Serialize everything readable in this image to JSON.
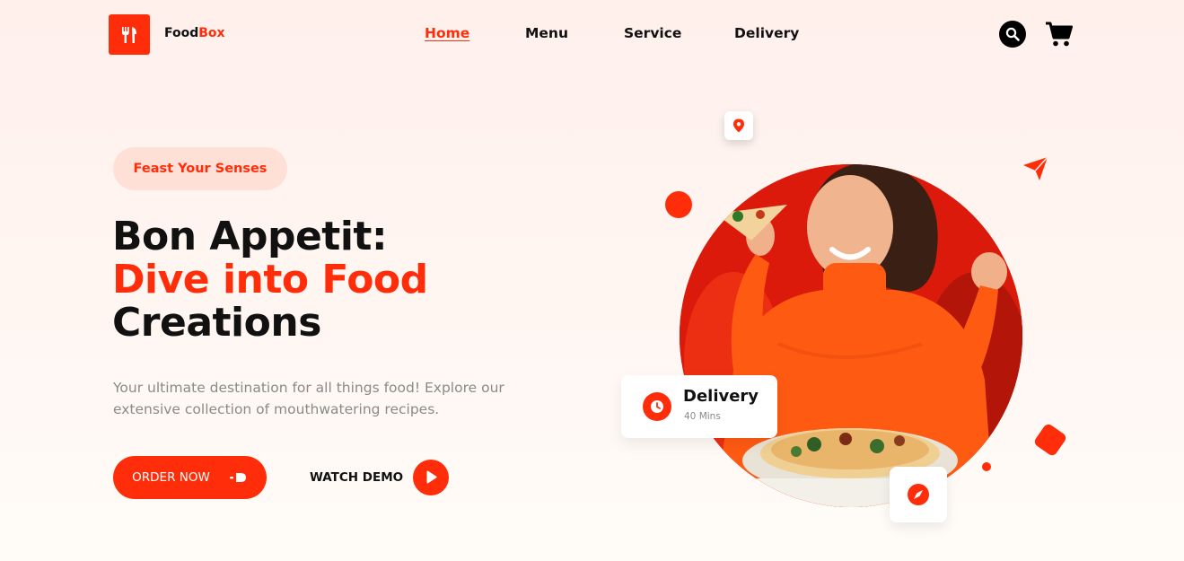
{
  "header": {
    "brand_part1": "Food",
    "brand_part2": "Box",
    "nav": [
      {
        "label": "Home",
        "active": true
      },
      {
        "label": "Menu",
        "active": false
      },
      {
        "label": "Service",
        "active": false
      },
      {
        "label": "Delivery",
        "active": false
      }
    ],
    "icons": [
      "fork-knife-icon",
      "search-icon",
      "cart-icon"
    ]
  },
  "hero": {
    "badge": "Feast Your Senses",
    "title_line1": "Bon Appetit:",
    "title_line2": "Dive into Food",
    "title_line3": "Creations",
    "description": "Your ultimate destination for all things food! Explore our extensive collection of mouthwatering recipes.",
    "order_button": "ORDER NOW",
    "watch_demo": "WATCH DEMO"
  },
  "delivery_card": {
    "title": "Delivery",
    "subtitle": "40 Mins"
  },
  "decor_icons": [
    "location-pin-icon",
    "send-plane-icon",
    "compass-icon",
    "clock-icon",
    "play-icon",
    "arrow-right-icon"
  ],
  "colors": {
    "accent": "#ff2d0a",
    "badge_bg": "#ffe0d6",
    "text_dark": "#111111",
    "text_muted": "#8a8a8a"
  }
}
